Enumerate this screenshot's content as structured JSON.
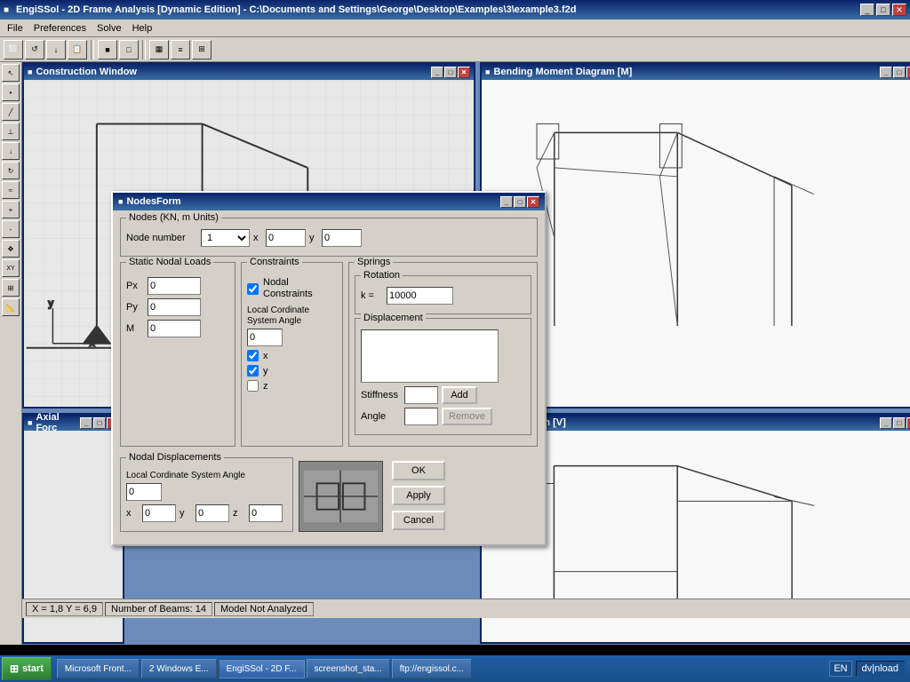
{
  "app": {
    "title": "EngiSSol - 2D Frame Analysis [Dynamic Edition] - C:\\Documents and Settings\\George\\Desktop\\Examples\\3\\example3.f2d",
    "icon": "■"
  },
  "menu": {
    "items": [
      "File",
      "Preferences",
      "Solve",
      "Help"
    ]
  },
  "toolbar": {
    "buttons": [
      "⬜",
      "⬛",
      "↓",
      "📋",
      "■",
      "□",
      "▦",
      "≡",
      "⊞"
    ]
  },
  "windows": {
    "construction": {
      "title": "Construction Window",
      "icon": "■"
    },
    "bending": {
      "title": "Bending Moment Diagram [M]",
      "icon": "■"
    },
    "axial": {
      "title": "Axial Forc",
      "icon": "■"
    },
    "shear": {
      "title": "rce Diagram [V]",
      "icon": "■"
    }
  },
  "nodes_form": {
    "title": "NodesForm",
    "icon": "■",
    "nodes_group": {
      "label": "Nodes (KN, m Units)",
      "node_number_label": "Node number",
      "node_number_value": "1",
      "x_label": "x",
      "x_value": "0",
      "y_label": "y",
      "y_value": "0"
    },
    "static_loads": {
      "label": "Static Nodal Loads",
      "px_label": "Px",
      "px_value": "0",
      "py_label": "Py",
      "py_value": "0",
      "m_label": "M",
      "m_value": "0"
    },
    "constraints": {
      "label": "Constraints",
      "nodal_constraints_label": "Nodal Constraints",
      "nodal_constraints_checked": true,
      "local_cordinate_label": "Local Cordinate System Angle",
      "local_cordinate_value": "0",
      "x_label": "x",
      "x_checked": true,
      "y_label": "y",
      "y_checked": true,
      "z_label": "z",
      "z_checked": false
    },
    "springs": {
      "label": "Springs",
      "rotation": {
        "label": "Rotation",
        "k_label": "k =",
        "k_value": "10000"
      },
      "displacement": {
        "label": "Displacement",
        "stiffness_label": "Stiffness",
        "stiffness_value": "",
        "angle_label": "Angle",
        "angle_value": "",
        "add_label": "Add",
        "remove_label": "Remove"
      }
    },
    "nodal_displacements": {
      "label": "Nodal Displacements",
      "local_cordinate_label": "Local Cordinate System Angle",
      "local_cordinate_value": "0",
      "x_label": "x",
      "x_value": "0",
      "y_label": "y",
      "y_value": "0",
      "z_label": "z",
      "z_value": "0"
    },
    "buttons": {
      "ok_label": "OK",
      "apply_label": "Apply",
      "cancel_label": "Cancel"
    }
  },
  "status_bar": {
    "coordinates": "X = 1,8   Y = 6,9",
    "beams": "Number of Beams: 14",
    "analysis": "Model Not Analyzed"
  },
  "taskbar": {
    "start_label": "start",
    "items": [
      "Microsoft Front...",
      "2 Windows E...",
      "EngiSSol - 2D F...",
      "screenshot_sta...",
      "ftp://engissol.c..."
    ],
    "lang": "EN"
  }
}
